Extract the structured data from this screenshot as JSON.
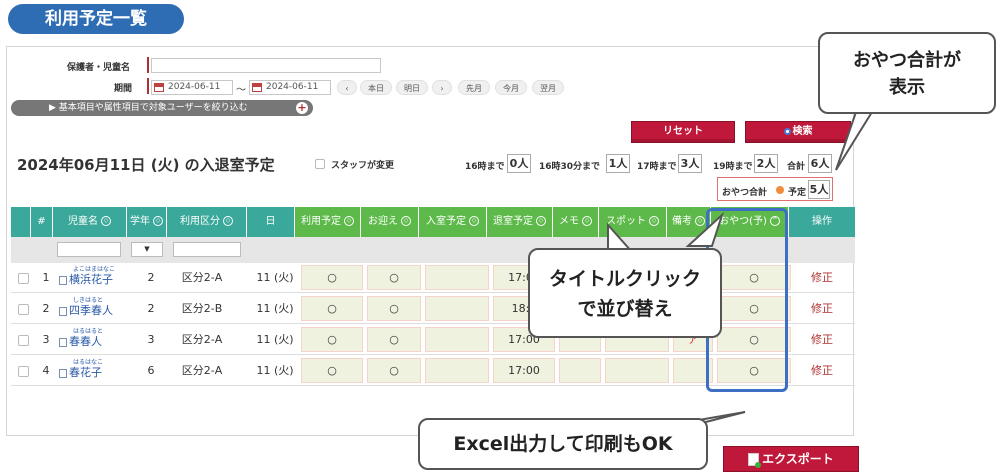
{
  "heading": "利用予定一覧",
  "search": {
    "guardian_label": "保護者・児童名",
    "guardian_value": "",
    "period_label": "期間",
    "date_from": "2024-06-11",
    "date_to": "2024-06-11",
    "tilde": "～",
    "nav": [
      "‹",
      "本日",
      "明日",
      "›",
      "先月",
      "今月",
      "翌月"
    ],
    "filter_label": "▶ 基本項目や属性項目で対象ユーザーを絞り込む",
    "plus": "+"
  },
  "buttons": {
    "reset": "リセット",
    "search": "検索",
    "export": "エクスポート"
  },
  "summary": {
    "title": "2024年06月11日 (火) の入退室予定",
    "staff_change": "スタッフが変更",
    "counts": [
      {
        "label": "16時まで",
        "value": "0人"
      },
      {
        "label": "16時30分まで",
        "value": "1人"
      },
      {
        "label": "17時まで",
        "value": "3人"
      },
      {
        "label": "19時まで",
        "value": "2人"
      },
      {
        "label": "合計",
        "value": "6人"
      }
    ],
    "snack_label": "おやつ合計",
    "snack_sub": "予定",
    "snack_value": "5人"
  },
  "table": {
    "headers": [
      "#",
      "児童名",
      "学年",
      "利用区分",
      "日",
      "利用予定",
      "お迎え",
      "入室予定",
      "退室予定",
      "メモ",
      "スポット",
      "備考",
      "おやつ(予)",
      "操作"
    ],
    "rows": [
      {
        "no": "1",
        "ruby": "よこはまはなこ",
        "name": "横浜花子",
        "grade": "2",
        "class": "区分2-A",
        "day": "11 (火)",
        "use": "○",
        "pickup": "○",
        "exit": "17:00",
        "note": "",
        "snack": "○",
        "op": "修正"
      },
      {
        "no": "2",
        "ruby": "しきはると",
        "name": "四季春人",
        "grade": "2",
        "class": "区分2-B",
        "day": "11 (火)",
        "use": "○",
        "pickup": "○",
        "exit": "18:0",
        "note": "",
        "snack": "○",
        "op": "修正"
      },
      {
        "no": "3",
        "ruby": "はるはると",
        "name": "春春人",
        "grade": "3",
        "class": "区分2-A",
        "day": "11 (火)",
        "use": "○",
        "pickup": "○",
        "exit": "17:00",
        "note": "ア",
        "snack": "○",
        "op": "修正"
      },
      {
        "no": "4",
        "ruby": "はるはなこ",
        "name": "春花子",
        "grade": "6",
        "class": "区分2-A",
        "day": "11 (火)",
        "use": "○",
        "pickup": "○",
        "exit": "17:00",
        "note": "",
        "snack": "○",
        "op": "修正"
      }
    ]
  },
  "callouts": {
    "snack_total": "おやつ合計が\n表示",
    "sort": "タイトルクリック\nで並び替え",
    "excel": "Excel出力して印刷もOK"
  },
  "colors": {
    "heading": "#2e6db4",
    "header": "#3aa89a",
    "header_green": "#5dba4a",
    "button": "#c0183a",
    "highlight": "#3d6fc4"
  }
}
